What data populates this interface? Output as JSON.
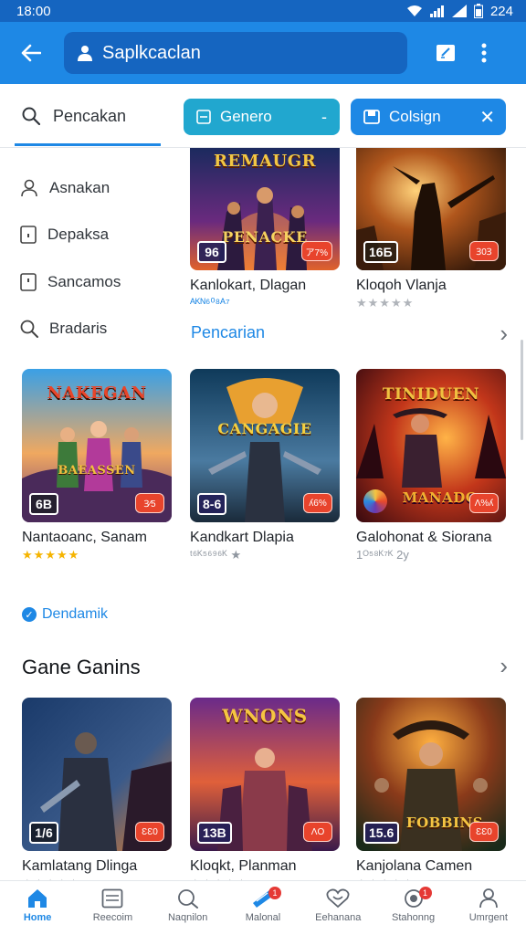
{
  "status_bar": {
    "time": "18:00",
    "battery": "224"
  },
  "app_bar": {
    "title": "Saplkcaclan"
  },
  "filters": {
    "search_tab": "Pencakan",
    "genre_chip": "Genero",
    "close_chip": "Colsign"
  },
  "sidebar": {
    "items": [
      {
        "label": "Asnakan",
        "icon": "user-outline-icon"
      },
      {
        "label": "Depaksa",
        "icon": "bookmark-icon"
      },
      {
        "label": "Sancamos",
        "icon": "bookmark-icon"
      },
      {
        "label": "Bradaris",
        "icon": "search-icon"
      }
    ]
  },
  "top_row": [
    {
      "art_title_1": "REMAUGR",
      "art_title_2": "PENACKE",
      "badge_left": "96",
      "badge_right": "ア7%",
      "title": "Kanlokart, Dlagan",
      "sub": "ᴬᴷᴺ⁶⁰⁸ᴬ⁷",
      "sub_style": "blue"
    },
    {
      "art_title_1": "",
      "art_title_2": "",
      "badge_left": "16Б",
      "badge_right": "Ɜ0Ɜ",
      "title": "Kloqoh Vlanja",
      "sub": "★★★★★",
      "sub_style": "grey-stars"
    }
  ],
  "section_link": "Pencarian",
  "middle_row": [
    {
      "art_title_1": "NAKEGAN",
      "art_title_2": "BAEASSEN",
      "badge_left": "6B",
      "badge_right": "Ɜ⁄5",
      "title": "Nantaoanc, Sanam",
      "sub": "★★★★★",
      "sub_style": "gold-stars"
    },
    {
      "art_title_1": "CANGAGIE",
      "art_title_2": "",
      "badge_left": "8-6",
      "badge_right": "ʎ6%",
      "title": "Kandkart Dlapia",
      "sub": "ᵗ⁶ᴷ⁵⁶⁹⁶ᴷ ★",
      "sub_style": "grey-gold"
    },
    {
      "art_title_1": "TINIDUEN",
      "art_title_2": "MANADO",
      "badge_left": "",
      "badge_right": "Ʌ%ʎ",
      "title": "Galohonat & Siorana",
      "sub": "1ᴼ⁵⁸ᴷ⁷ᴷ 2y",
      "sub_style": "grey"
    }
  ],
  "verified_label": "Dendamik",
  "section_title": "Gane Ganins",
  "bottom_row": [
    {
      "art_title_1": "",
      "art_title_2": "",
      "badge_left": "1/6",
      "badge_right": "ƐƐ0",
      "title": "Kamlatang Dlinga",
      "sub": "★★★★★",
      "sub_style": "grey-stars"
    },
    {
      "art_title_1": "WNONS",
      "art_title_2": "",
      "badge_left": "13B",
      "badge_right": "ɅO",
      "title": "Kloqkt, Planman",
      "sub": "★★★★★",
      "sub_style": "grey-stars"
    },
    {
      "art_title_1": "",
      "art_title_2": "FOBBINS",
      "badge_left": "15.6",
      "badge_right": "ƐƐ0",
      "title": "Kanjolana Camen",
      "sub": "★★★★★",
      "sub_style": "grey-stars"
    }
  ],
  "bottom_nav": [
    {
      "label": "Home",
      "icon": "home-icon",
      "active": true
    },
    {
      "label": "Reecoim",
      "icon": "inbox-icon",
      "active": false
    },
    {
      "label": "Naqnilon",
      "icon": "search-icon",
      "active": false
    },
    {
      "label": "Malonal",
      "icon": "ticket-icon",
      "active": false,
      "badge": "1"
    },
    {
      "label": "Eehanana",
      "icon": "heart-chat-icon",
      "active": false
    },
    {
      "label": "Stahonng",
      "icon": "notification-icon",
      "active": false,
      "badge": "1"
    },
    {
      "label": "Umrgent",
      "icon": "profile-icon",
      "active": false
    }
  ],
  "colors": {
    "primary": "#1e88e5",
    "primary_dark": "#1565c0",
    "chip_teal": "#21a7cf",
    "badge_red": "#e8442c"
  }
}
